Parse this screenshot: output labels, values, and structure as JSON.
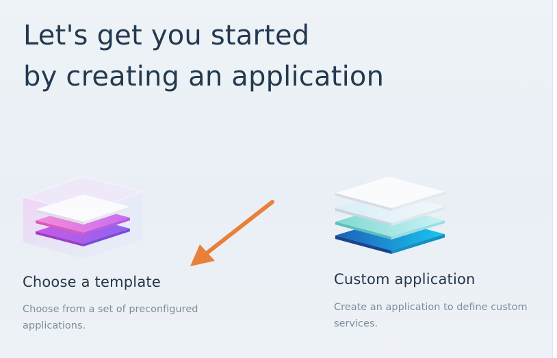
{
  "headline": {
    "line1": "Let's get you started",
    "line2": "by creating an application"
  },
  "options": [
    {
      "title": "Choose a template",
      "description": "Choose from a set of preconfigured applications.",
      "icon": "stacked-layers-box-icon"
    },
    {
      "title": "Custom application",
      "description": "Create an application to define custom services.",
      "icon": "stacked-layers-icon"
    }
  ],
  "annotation": {
    "arrow_color": "#e8803a"
  },
  "colors": {
    "heading": "#23394f",
    "description": "#7e8d9b",
    "template_accent": "#c45fe8",
    "custom_accent": "#1a8fe0"
  }
}
